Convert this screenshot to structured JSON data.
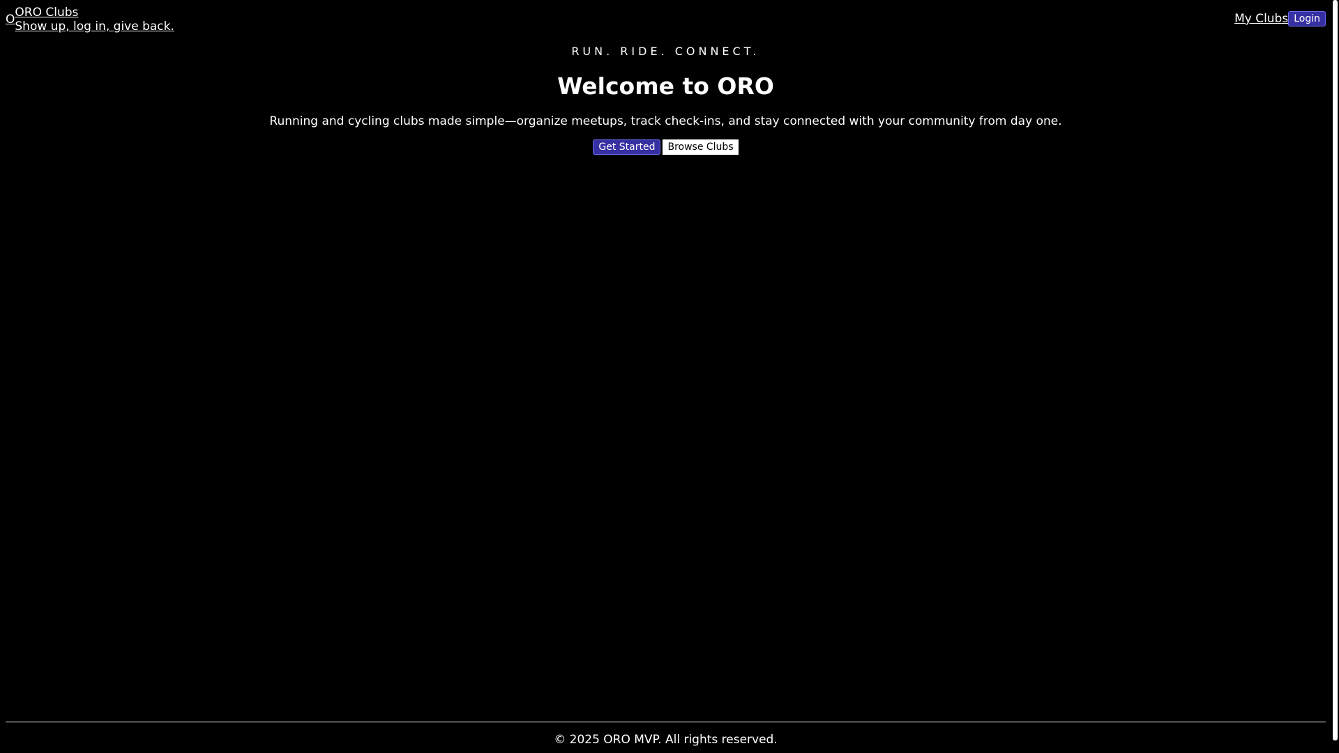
{
  "header": {
    "brand_mark": "O",
    "brand_name": "ORO Clubs",
    "brand_tagline": "Show up, log in, give back.",
    "nav_my_clubs": "My Clubs",
    "nav_login": "Login"
  },
  "hero": {
    "tagline": "RUN. RIDE. CONNECT.",
    "title": "Welcome to ORO",
    "subtitle": "Running and cycling clubs made simple—organize meetups, track check-ins, and stay connected with your community from day one.",
    "primary_cta": "Get Started",
    "secondary_cta": "Browse Clubs"
  },
  "footer": {
    "copyright": "© 2025 ORO MVP. All rights reserved."
  },
  "colors": {
    "background": "#000000",
    "text": "#ffffff",
    "accent": "#3730a3"
  }
}
